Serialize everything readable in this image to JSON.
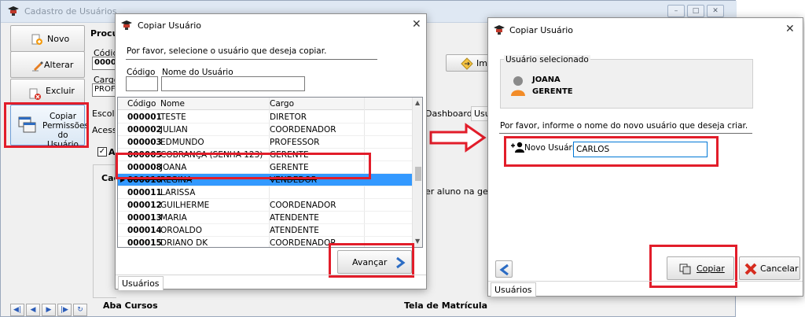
{
  "main": {
    "title": "Cadastro de Usuários",
    "sidebar": {
      "novo": "Novo",
      "alterar": "Alterar",
      "excluir": "Excluir",
      "copiar_permissoes": [
        "Copiar",
        "Permissões",
        "do Usuário"
      ]
    },
    "fragments": {
      "procura": "Procura",
      "codigo_label": "Códig",
      "codigo_value": "0000",
      "cargo_label": "Cargo",
      "cargo_value": "PROF",
      "escola": "Escola",
      "acesso": "Acesso",
      "check_al": "Al",
      "cad": "Cad",
      "imp": "Imp",
      "dashboards": "Dashboards",
      "us": "Usu",
      "aluno_text": "er aluno na geraçã",
      "aba_cursos": "Aba Cursos",
      "tela_matricula": "Tela de Matrícula"
    },
    "nav_icons": [
      "first-icon",
      "prev-icon",
      "next-icon",
      "last-icon",
      "refresh-icon"
    ]
  },
  "dialog1": {
    "title": "Copiar Usuário",
    "instruction": "Por favor, selecione o usuário que deseja copiar.",
    "codigo_label": "Código",
    "nome_label": "Nome do Usuário",
    "columns": [
      "Código",
      "Nome",
      "Cargo"
    ],
    "rows": [
      {
        "codigo": "000001",
        "nome": "TESTE",
        "cargo": "DIRETOR"
      },
      {
        "codigo": "000002",
        "nome": "JULIAN",
        "cargo": "COORDENADOR"
      },
      {
        "codigo": "000003",
        "nome": "EDMUNDO",
        "cargo": "PROFESSOR"
      },
      {
        "codigo": "000005",
        "nome": "COBRANÇA (SENHA 123)",
        "cargo": "GERENTE"
      },
      {
        "codigo": "000008",
        "nome": "JOANA",
        "cargo": "GERENTE"
      },
      {
        "codigo": "000010",
        "nome": "REGINA",
        "cargo": "VENDEDOR"
      },
      {
        "codigo": "000011",
        "nome": "LARISSA",
        "cargo": ""
      },
      {
        "codigo": "000012",
        "nome": "GUILHERME",
        "cargo": "COORDENADOR"
      },
      {
        "codigo": "000013",
        "nome": "MARIA",
        "cargo": "ATENDENTE"
      },
      {
        "codigo": "000014",
        "nome": "OROALDO",
        "cargo": "ATENDENTE"
      },
      {
        "codigo": "000015",
        "nome": "DRIANO DK",
        "cargo": "COORDENADOR"
      }
    ],
    "avancar": "Avançar",
    "tab": "Usuários"
  },
  "dialog2": {
    "title": "Copiar Usuário",
    "group_label": "Usuário selecionado",
    "user_name": "JOANA",
    "user_role": "GERENTE",
    "instruction": "Por favor, informe o nome do novo usuário que deseja criar.",
    "novo_usuario_label": "Novo Usuário:",
    "novo_usuario_value": "CARLOS",
    "copiar": "Copiar",
    "cancelar": "Cancelar",
    "tab": "Usuários"
  },
  "colors": {
    "highlight": "#e21d2a",
    "selection": "#3399ff",
    "accent_blue": "#2b6cc4"
  }
}
